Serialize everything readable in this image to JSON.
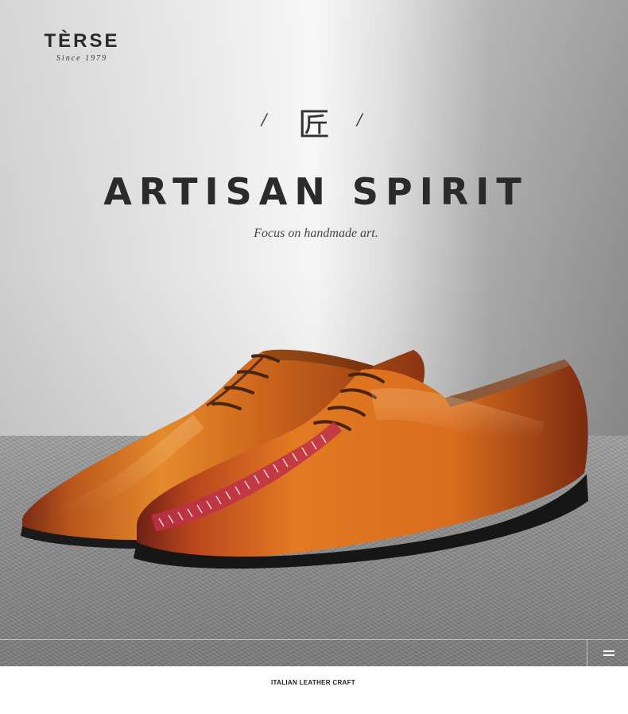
{
  "brand": {
    "name": "TÈRSE",
    "since": "Since 1979"
  },
  "hero": {
    "slash_left": "/",
    "glyph": "匠",
    "slash_right": "/",
    "headline": "ARTISAN SPIRIT",
    "tagline": "Focus on handmade art.",
    "image_subject": "shoe-illustration"
  },
  "footer": {
    "caption": "ITALIAN LEATHER CRAFT",
    "menu_icon": "menu-icon"
  },
  "colors": {
    "leather": "#d06a1c",
    "leather_dark": "#7a2a12",
    "stitch_red": "#c0304a",
    "sole": "#1a1a1a"
  }
}
